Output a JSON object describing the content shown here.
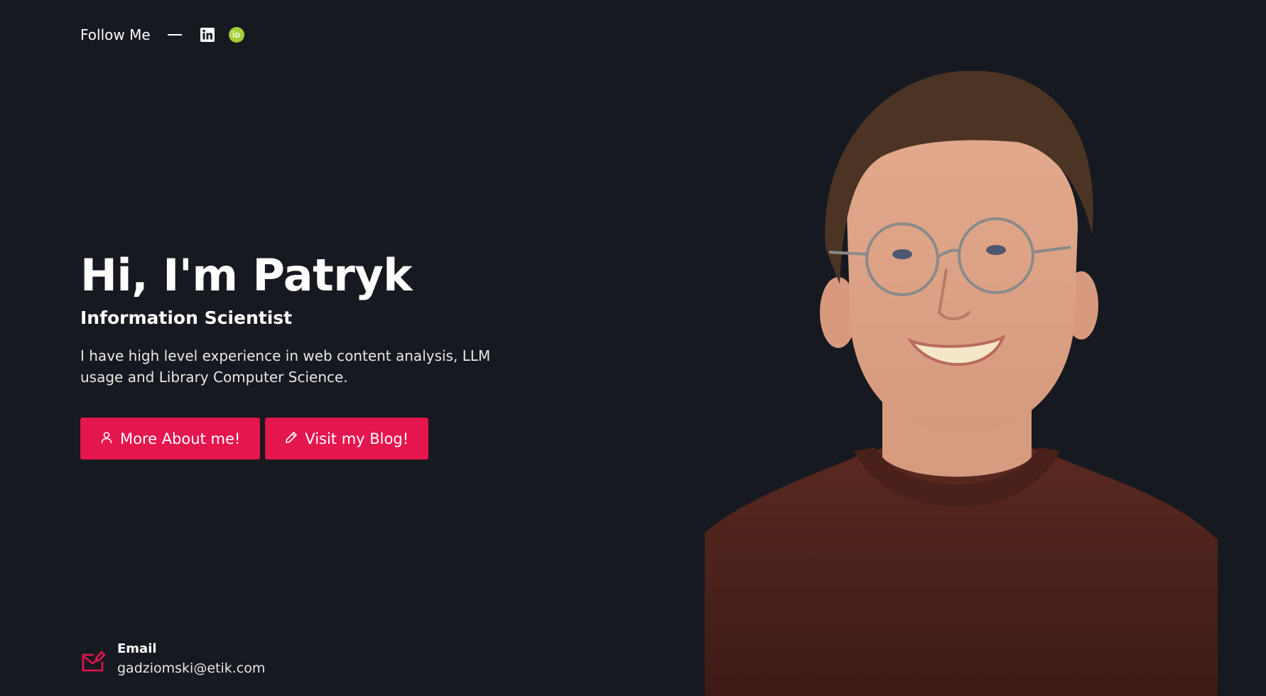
{
  "header": {
    "follow_label": "Follow Me",
    "social_icons": [
      "linkedin-icon",
      "orcid-icon"
    ]
  },
  "hero": {
    "title": "Hi, I'm Patryk",
    "subtitle": "Information Scientist",
    "description": "I have high level experience in web content analysis, LLM usage and Library Computer Science.",
    "buttons": {
      "about_label": "More About me!",
      "blog_label": "Visit my Blog!"
    }
  },
  "contact": {
    "email_label": "Email",
    "email_value": "gadziomski@etik.com"
  },
  "colors": {
    "background": "#171920",
    "accent": "#e5154e",
    "orcid": "#a6ce39"
  }
}
